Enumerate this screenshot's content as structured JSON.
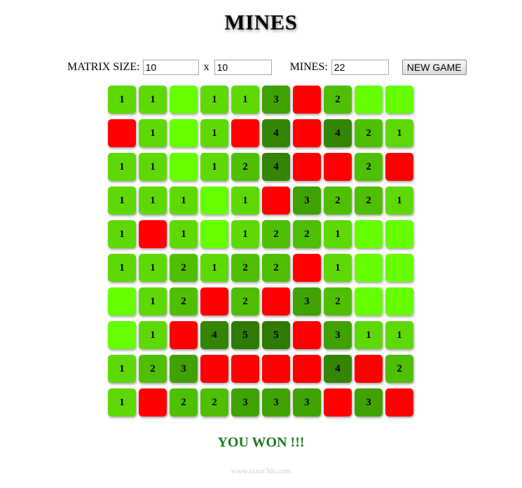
{
  "title": "MINES",
  "controls": {
    "matrix_size_label": "MATRIX SIZE:",
    "rows_value": "10",
    "separator": "x",
    "cols_value": "10",
    "mines_label": "MINES:",
    "mines_value": "22",
    "new_game_label": "NEW GAME"
  },
  "board": {
    "rows": [
      [
        "1",
        "1",
        "",
        "1",
        "1",
        "3",
        "M",
        "2",
        "",
        ""
      ],
      [
        "M",
        "1",
        "",
        "1",
        "M",
        "4",
        "M",
        "4",
        "2",
        "1"
      ],
      [
        "1",
        "1",
        "",
        "1",
        "2",
        "4",
        "M",
        "M",
        "2",
        "M"
      ],
      [
        "1",
        "1",
        "1",
        "",
        "1",
        "M",
        "3",
        "2",
        "2",
        "1"
      ],
      [
        "1",
        "M",
        "1",
        "",
        "1",
        "2",
        "2",
        "1",
        "",
        ""
      ],
      [
        "1",
        "1",
        "2",
        "1",
        "2",
        "2",
        "M",
        "1",
        "",
        ""
      ],
      [
        "",
        "1",
        "2",
        "M",
        "2",
        "M",
        "3",
        "2",
        "",
        ""
      ],
      [
        "",
        "1",
        "M",
        "4",
        "5",
        "5",
        "M",
        "3",
        "1",
        "1"
      ],
      [
        "1",
        "2",
        "3",
        "M",
        "M",
        "M",
        "M",
        "4",
        "M",
        "2"
      ],
      [
        "1",
        "M",
        "2",
        "2",
        "3",
        "3",
        "3",
        "M",
        "3",
        "M"
      ]
    ]
  },
  "colors": {
    "mine": "#ff0000",
    "empty": "#66ff00",
    "n1": "#5ed905",
    "n2": "#4fbf03",
    "n3": "#3fa102",
    "n4": "#338503",
    "n5": "#2e7a02"
  },
  "status_text": "YOU WON !!!",
  "footer_text": "www.razor3ds.com"
}
